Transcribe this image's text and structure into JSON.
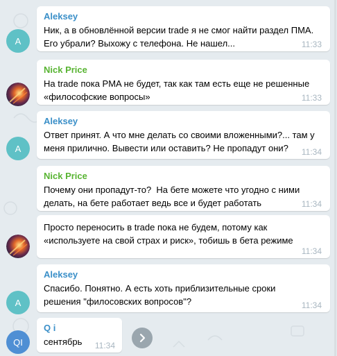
{
  "colors": {
    "background": "#e5ebef",
    "aleksey_name": "#3a8fc8",
    "nick_name": "#58b432",
    "qi_name": "#3a8fc8",
    "avatar_aleksey": "#5fc1c6",
    "avatar_qi": "#4f8fd4"
  },
  "messages": [
    {
      "sender": "Aleksey",
      "avatar_text": "A",
      "text": "Ник, а в обновлённой версии trade я не смог найти раздел ПМА.\nЕго убрали? Выхожу с телефона. Не нашел...",
      "time": "11:33"
    },
    {
      "sender": "Nick Price",
      "text": "На trade пока PMA не будет, так как там есть еще не решенные\n«философские вопросы»",
      "time": "11:33"
    },
    {
      "sender": "Aleksey",
      "avatar_text": "A",
      "text": "Ответ принят. А что мне делать со своими вложенными?... там у\nменя прилично. Вывести или оставить? Не пропадут они?",
      "time": "11:34"
    },
    {
      "sender": "Nick Price",
      "text": "Почему они пропадут-то?  На бете можете что угодно с ними\nделать, на бете работает ведь все и будет работать",
      "time": "11:34"
    },
    {
      "text": "Просто переносить в trade пока не будем, потому как\n«используете на свой страх и риск», тобишь в бета режиме",
      "time": "11:34"
    },
    {
      "sender": "Aleksey",
      "avatar_text": "A",
      "text": "Спасибо. Понятно. А есть хоть приблизительные сроки\nрешения \"филосовских вопросов\"?",
      "time": "11:34"
    },
    {
      "sender": "Q i",
      "avatar_text": "QI",
      "text": "сентябрь",
      "time": "11:34"
    }
  ],
  "icons": {
    "scroll_down": "chevron-right-icon",
    "nick_avatar": "nick-price-avatar-image"
  }
}
